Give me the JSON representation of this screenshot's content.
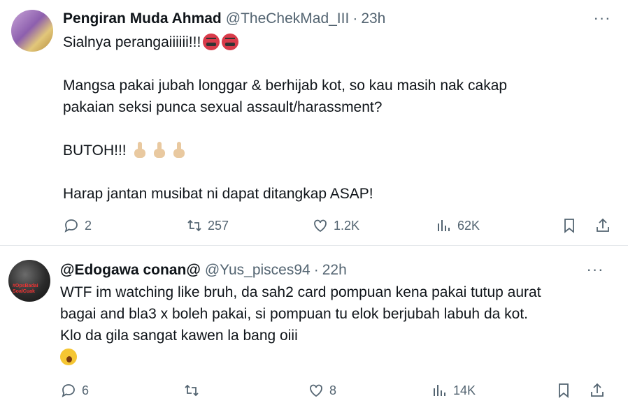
{
  "tweets": [
    {
      "author_name": "Pengiran Muda Ahmad",
      "handle": "@TheChekMad_III",
      "separator": "·",
      "time": "23h",
      "more_label": "···",
      "lines": [
        "Sialnyaperangaiiiiii!!!",
        "",
        "Mangsa pakai jubah longgar & berhijab kot, so kau masih nak cakap",
        "pakaian seksi punca sexual assault/harassment?",
        "",
        "BUTOH!!!",
        "",
        "Harap jantan musibat ni dapat ditangkap ASAP!"
      ],
      "emojis": [
        "face-with-symbols-on-mouth",
        "middle-finger-light-skin"
      ],
      "stats": {
        "replies": "2",
        "retweets": "257",
        "likes": "1.2K",
        "views": "62K"
      }
    },
    {
      "author_name": "@Edogawa conan@",
      "handle": "@Yus_pisces94",
      "separator": "·",
      "time": "22h",
      "more_label": "···",
      "lines": [
        "WTF im watching like bruh, da sah2 card pompuan kena pakai tutup aurat",
        "bagai and bla3 x boleh pakai, si pompuan tu elok berjubah labuh da kot.",
        "Klo da gila sangat kawen la bang oiii"
      ],
      "emojis": [
        "yawning-face"
      ],
      "stats": {
        "replies": "6",
        "retweets": "",
        "likes": "8",
        "views": "14K"
      }
    }
  ],
  "avatar2_text": "#OpsBadai\nSoalCuak",
  "colors": {
    "text": "#0f1419",
    "muted": "#536471",
    "divider": "#e6e9ec"
  }
}
